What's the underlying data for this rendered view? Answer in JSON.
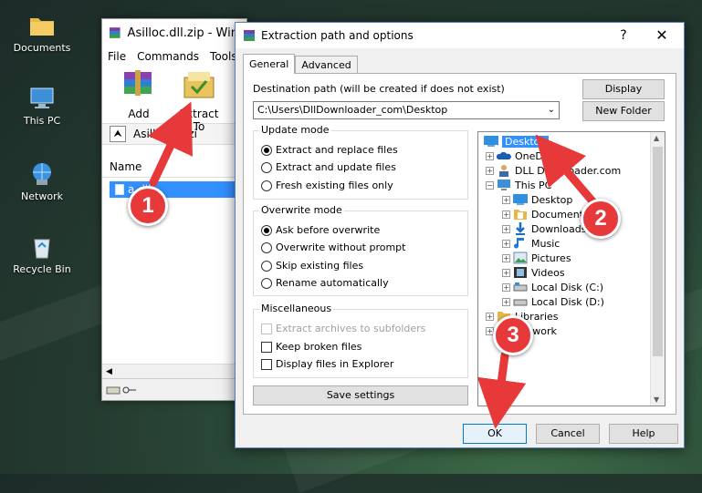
{
  "desktop": {
    "icons": [
      {
        "label": "Documents",
        "icon": "folder-icon"
      },
      {
        "label": "This PC",
        "icon": "computer-icon"
      },
      {
        "label": "Network",
        "icon": "network-icon"
      },
      {
        "label": "Recycle Bin",
        "icon": "recycle-bin-icon"
      }
    ]
  },
  "winrar": {
    "title": "Asilloc.dll.zip - WinR",
    "menu": [
      "File",
      "Commands",
      "Tools"
    ],
    "toolbar": [
      {
        "label": "Add",
        "icon": "add-archive-icon"
      },
      {
        "label": "Extract To",
        "icon": "extract-to-icon"
      }
    ],
    "path": "Asilloc.dll.zi",
    "column_name": "Name",
    "file_row": "a      dll"
  },
  "dialog": {
    "title": "Extraction path and options",
    "help": "?",
    "close": "✕",
    "tabs": [
      "General",
      "Advanced"
    ],
    "destination_label": "Destination path (will be created if does not exist)",
    "destination_value": "C:\\Users\\DllDownloader_com\\Desktop",
    "display_button": "Display",
    "new_folder_button": "New Folder",
    "update_mode": {
      "title": "Update mode",
      "options": [
        "Extract and replace files",
        "Extract and update files",
        "Fresh existing files only"
      ],
      "selected": 0
    },
    "overwrite_mode": {
      "title": "Overwrite mode",
      "options": [
        "Ask before overwrite",
        "Overwrite without prompt",
        "Skip existing files",
        "Rename automatically"
      ],
      "selected": 0
    },
    "misc": {
      "title": "Miscellaneous",
      "options": [
        "Extract archives to subfolders",
        "Keep broken files",
        "Display files in Explorer"
      ]
    },
    "save_settings": "Save settings",
    "tree": [
      "Desktop",
      "OneD",
      "DLL Downloader.com",
      "This PC",
      "Desktop",
      "Documents",
      "Downloads",
      "Music",
      "Pictures",
      "Videos",
      "Local Disk (C:)",
      "Local Disk (D:)",
      "Libraries",
      "Network"
    ],
    "ok": "OK",
    "cancel": "Cancel",
    "help_button": "Help"
  },
  "annotations": [
    "1",
    "2",
    "3"
  ],
  "colors": {
    "selection": "#3390ff",
    "badge": "#e8393a",
    "accent_border": "#5a7fb8"
  }
}
